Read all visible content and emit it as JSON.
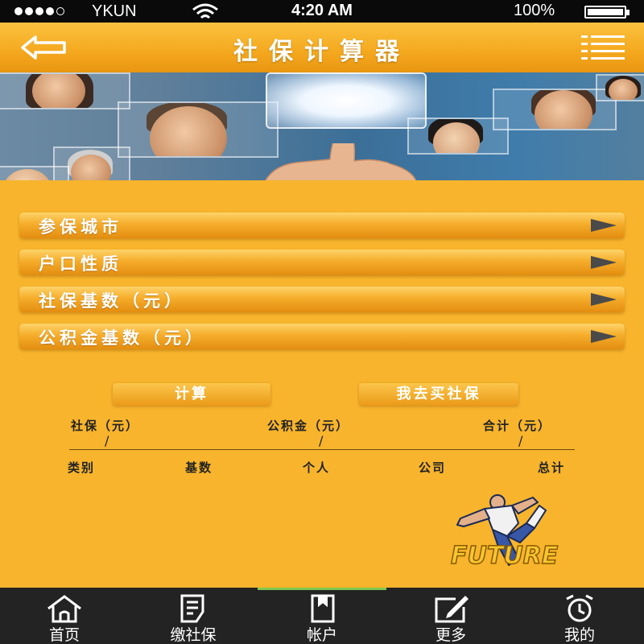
{
  "status_bar": {
    "carrier": "YKUN",
    "time": "4:20 AM",
    "battery": "100%"
  },
  "nav": {
    "title": "社保计算器",
    "back_icon": "back-arrow-icon",
    "menu_icon": "list-menu-icon"
  },
  "options": [
    {
      "label": "参保城市"
    },
    {
      "label": "户口性质"
    },
    {
      "label": "社保基数（元）"
    },
    {
      "label": "公积金基数（元）"
    }
  ],
  "buttons": {
    "calculate": "计算",
    "buy": "我去买社保"
  },
  "results": {
    "headers": [
      "社保（元）",
      "公积金（元）",
      "合计（元）"
    ],
    "separator": "/",
    "columns": [
      "类别",
      "基数",
      "个人",
      "公司",
      "总计"
    ]
  },
  "logo": {
    "text": "FUTURE"
  },
  "tabs": [
    {
      "label": "首页",
      "icon": "home-icon"
    },
    {
      "label": "缴社保",
      "icon": "document-icon"
    },
    {
      "label": "帐户",
      "icon": "folder-icon"
    },
    {
      "label": "更多",
      "icon": "edit-icon"
    },
    {
      "label": "我的",
      "icon": "alarm-clock-icon"
    }
  ],
  "colors": {
    "background": "#f7b42c",
    "tab_bar": "#232323",
    "active_indicator": "#7ec850"
  }
}
